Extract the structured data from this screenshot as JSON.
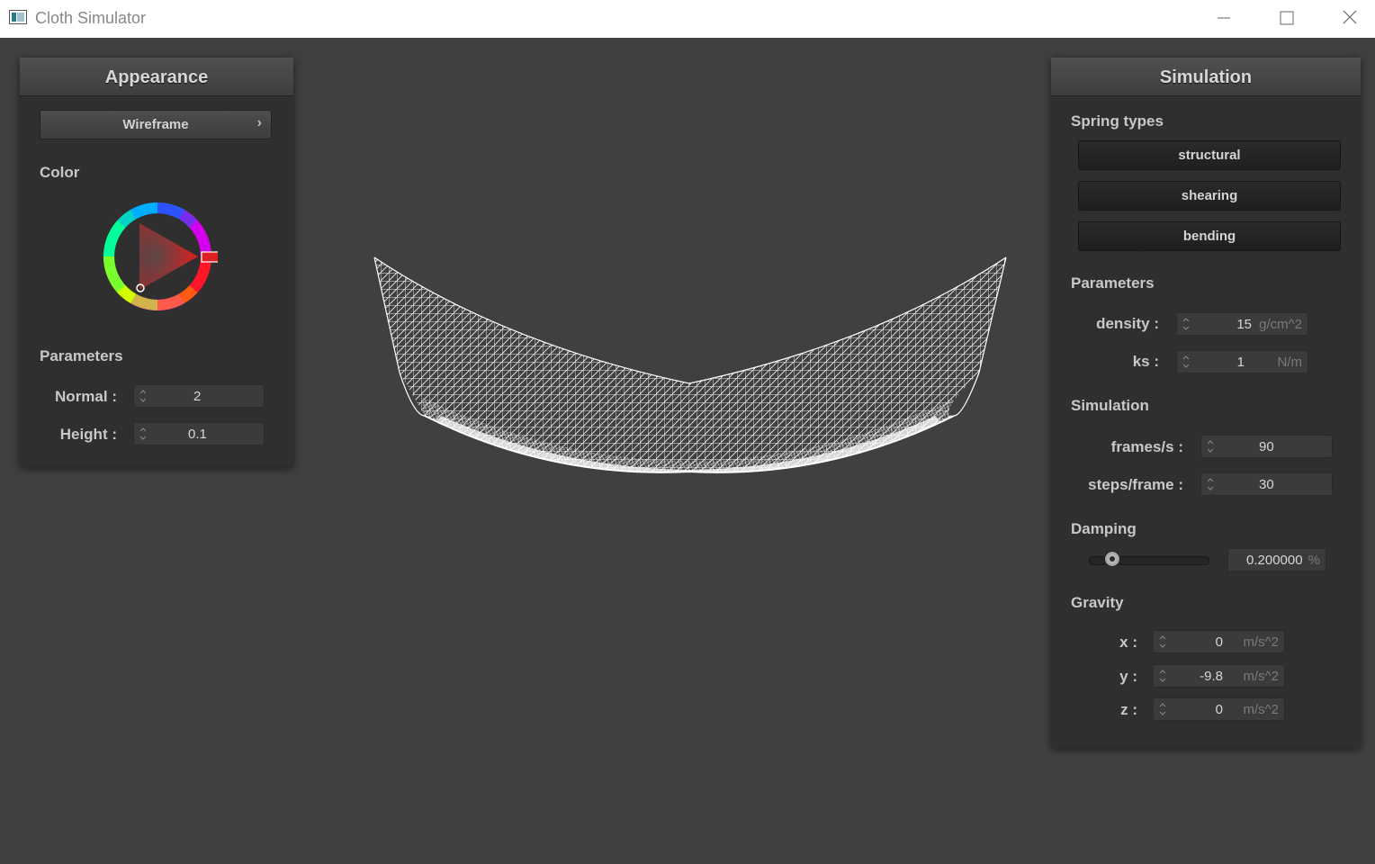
{
  "window": {
    "title": "Cloth Simulator"
  },
  "appearance": {
    "title": "Appearance",
    "shader_label": "Wireframe",
    "color_label": "Color",
    "color_value": "#e02020",
    "params_label": "Parameters",
    "normal_label": "Normal :",
    "normal_value": "2",
    "height_label": "Height :",
    "height_value": "0.1"
  },
  "simulation": {
    "title": "Simulation",
    "spring_types_label": "Spring types",
    "springs": [
      "structural",
      "shearing",
      "bending"
    ],
    "params_label": "Parameters",
    "density_label": "density :",
    "density_value": "15",
    "density_unit": "g/cm^2",
    "ks_label": "ks :",
    "ks_value": "1",
    "ks_unit": "N/m",
    "sim_label": "Simulation",
    "fps_label": "frames/s :",
    "fps_value": "90",
    "steps_label": "steps/frame :",
    "steps_value": "30",
    "damping_label": "Damping",
    "damping_value": "0.200000",
    "damping_unit": "%",
    "damping_fraction": 0.2,
    "gravity_label": "Gravity",
    "gx_label": "x :",
    "gx_value": "0",
    "gy_label": "y :",
    "gy_value": "-9.8",
    "gz_label": "z :",
    "gz_value": "0",
    "gravity_unit": "m/s^2"
  },
  "colors": {
    "viewport_bg": "#404040",
    "panel_bg": "#2f2f2f",
    "cloth": "#ffffff"
  }
}
